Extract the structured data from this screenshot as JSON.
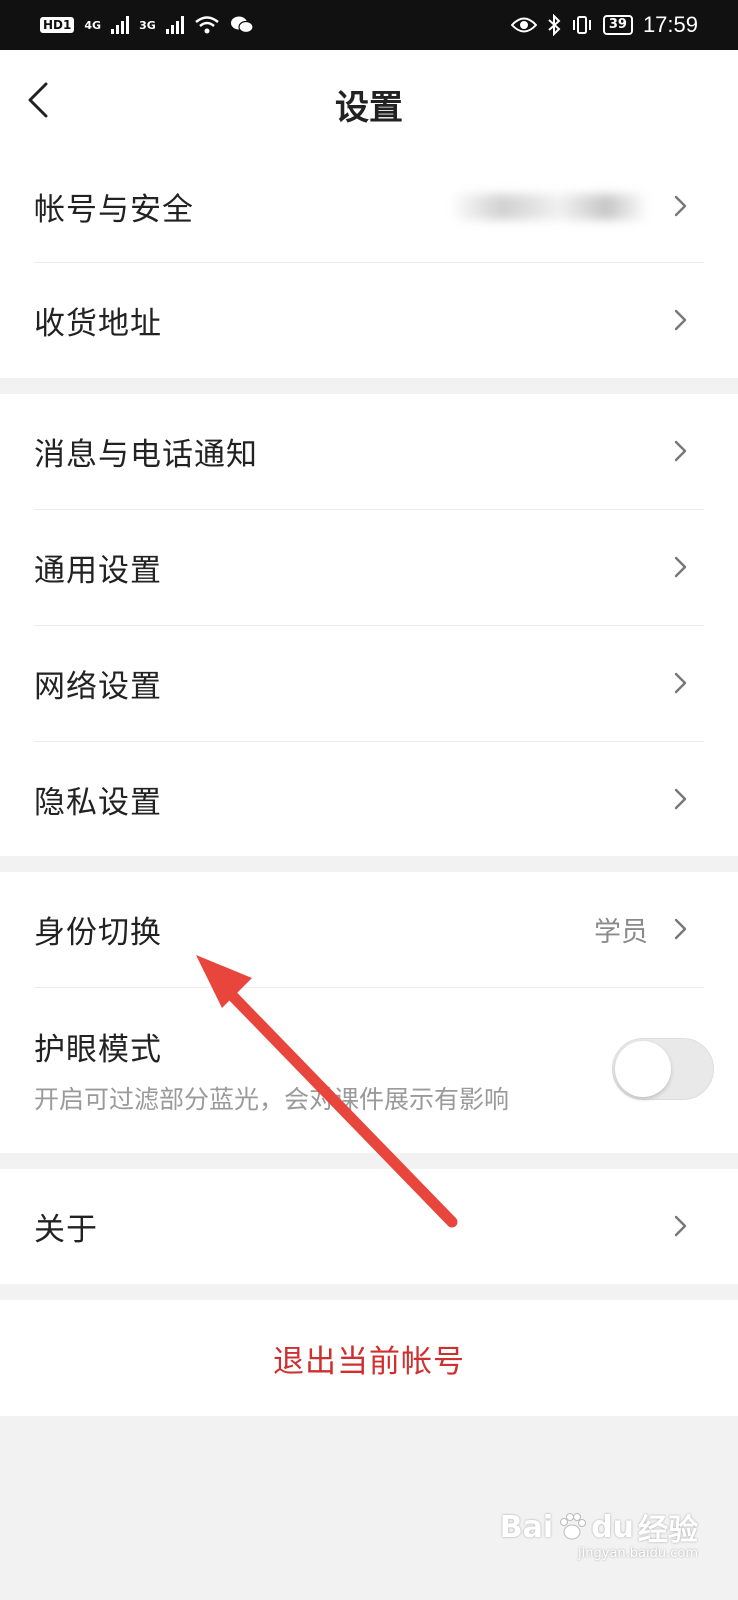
{
  "status_bar": {
    "hd_label": "HD",
    "sim1_label": "1",
    "net1": "4G",
    "net2": "3G",
    "battery": "39",
    "time": "17:59"
  },
  "header": {
    "title": "设置"
  },
  "groups": {
    "account": {
      "account_security": "帐号与安全",
      "shipping_address": "收货地址"
    },
    "settings": {
      "notifications": "消息与电话通知",
      "general": "通用设置",
      "network": "网络设置",
      "privacy": "隐私设置"
    },
    "identity": {
      "identity_switch": "身份切换",
      "identity_value": "学员",
      "eye_mode": "护眼模式",
      "eye_mode_desc": "开启可过滤部分蓝光，会对课件展示有影响",
      "eye_mode_enabled": false
    },
    "about": {
      "label": "关于"
    }
  },
  "logout": {
    "label": "退出当前帐号"
  },
  "watermark": {
    "brand": "Bai",
    "brand2": "du",
    "product": "经验",
    "url": "jingyan.baidu.com"
  },
  "colors": {
    "logout_red": "#cf2f2f",
    "annotation_arrow": "#e8453c"
  }
}
